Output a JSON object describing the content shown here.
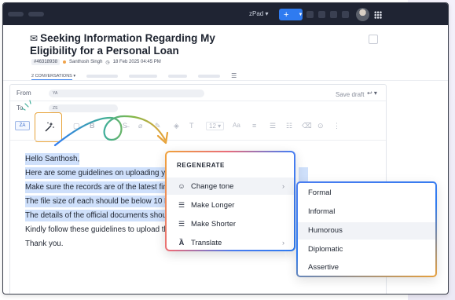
{
  "topbar": {
    "app_label": "zPad",
    "new_button_symbol": "+"
  },
  "ticket": {
    "title": "Seeking Information Regarding My Eligibility for a Personal Loan",
    "id": "#46318938",
    "contact": "Santhosh Singh",
    "date": "18 Feb 2025 04:45 PM",
    "conversations_tab": "2 CONVERSATIONS"
  },
  "compose": {
    "from_label": "From",
    "from_avatar": "YA",
    "to_label": "To",
    "to_avatar": "ZS",
    "save_draft": "Save draft",
    "font_size": "12",
    "lang_badge": "ZA"
  },
  "body_lines": [
    "Hello Santhosh,",
    "Here are some guidelines on uploading your",
    "Make sure the records are of the latest financ",
    "The file size of each should be below 10 MB.",
    "The details of the official documents should",
    "Kindly follow these guidelines to upload the d",
    "Thank you."
  ],
  "ai_menu": {
    "header": "REGENERATE",
    "items": [
      {
        "label": "Change tone",
        "icon": "smile-icon"
      },
      {
        "label": "Make Longer",
        "icon": "expand-lines-icon"
      },
      {
        "label": "Make Shorter",
        "icon": "shorten-lines-icon"
      },
      {
        "label": "Translate",
        "icon": "translate-icon"
      }
    ]
  },
  "tone_menu": {
    "options": [
      "Formal",
      "Informal",
      "Humorous",
      "Diplomatic",
      "Assertive"
    ],
    "hovered": "Humorous"
  },
  "colors": {
    "accent_blue": "#2f7bf0",
    "highlight": "#cfe0fb",
    "ai_orange": "#e7a33a",
    "topbar": "#1f2433"
  }
}
